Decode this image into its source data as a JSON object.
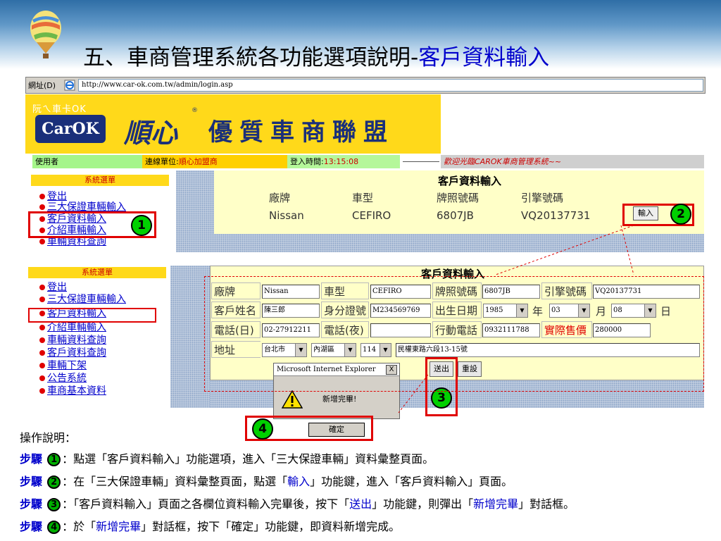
{
  "slide": {
    "title_main": "五、車商管理系統各功能選項說明-",
    "title_highlight": "客戶資料輸入"
  },
  "browser": {
    "address_label": "網址(D)",
    "url": "http://www.car-ok.com.tw/admin/login.asp"
  },
  "banner": {
    "logo_top": "阮ㄟ車卡OK",
    "logo_main": "CarOK",
    "brand_name": "順心",
    "brand_reg": "®",
    "alliance": "優質車商聯盟"
  },
  "status": {
    "user_label": "使用者",
    "unit_label": "連線單位:",
    "unit_value": "順心加盟商",
    "login_label": "登入時間:",
    "login_value": "13:15:08",
    "welcome": "歡迎光臨CAROK車商管理系統~~"
  },
  "menu_top": {
    "header": "系統選單",
    "items": [
      "登出",
      "三大保證車輛輸入",
      "客戶資料輸入",
      "介紹車輛輸入",
      "車輛資料查詢"
    ]
  },
  "panel_top": {
    "title": "客戶資料輸入",
    "headers": [
      "廠牌",
      "車型",
      "牌照號碼",
      "引擎號碼"
    ],
    "values": [
      "Nissan",
      "CEFIRO",
      "6807JB",
      "VQ20137731"
    ],
    "input_button": "輸入"
  },
  "menu_bottom": {
    "header": "系統選單",
    "items": [
      "登出",
      "三大保證車輛輸入",
      "客戶資料輸入",
      "介紹車輛輸入",
      "車輛資料查詢",
      "客戶資料查詢",
      "車輛下架",
      "公告系統",
      "車商基本資料"
    ]
  },
  "form": {
    "title": "客戶資料輸入",
    "brand_label": "廠牌",
    "brand_value": "Nissan",
    "model_label": "車型",
    "model_value": "CEFIRO",
    "plate_label": "牌照號碼",
    "plate_value": "6807JB",
    "engine_label": "引擎號碼",
    "engine_value": "VQ20137731",
    "name_label": "客戶姓名",
    "name_value": "陳三郎",
    "id_label": "身分證號",
    "id_value": "M234569769",
    "birth_label": "出生日期",
    "birth_year": "1985",
    "year_unit": "年",
    "birth_month": "03",
    "month_unit": "月",
    "birth_day": "08",
    "day_unit": "日",
    "phone_day_label": "電話(日)",
    "phone_day_value": "02-27912211",
    "phone_night_label": "電話(夜)",
    "phone_night_value": "",
    "mobile_label": "行動電話",
    "mobile_value": "0932111788",
    "price_label": "實際售價",
    "price_value": "280000",
    "address_label": "地址",
    "city": "台北市",
    "district": "內湖區",
    "zip": "114",
    "street": "民權東路六段13-15號",
    "submit_button": "送出",
    "reset_button": "重設"
  },
  "dialog": {
    "title": "Microsoft Internet Explorer",
    "close": "X",
    "message": "新增完畢!",
    "ok_button": "確定"
  },
  "badges": [
    "1",
    "2",
    "3",
    "4"
  ],
  "instructions": {
    "title": "操作說明：",
    "step_label": "步驟",
    "steps": [
      {
        "num": "1",
        "text": "：點選「客戶資料輸入」功能選項，進入「三大保證車輛」資料彙整頁面。"
      },
      {
        "num": "2",
        "pre": "：在「三大保證車輛」資料彙整頁面，點選「",
        "kw": "輸入",
        "post": "」功能鍵，進入「客戶資料輸入」頁面。"
      },
      {
        "num": "3",
        "pre": "：「客戶資料輸入」頁面之各欄位資料輸入完畢後，按下「",
        "kw": "送出",
        "mid": "」功能鍵，則彈出「",
        "kw2": "新增完畢",
        "post": "」對話框。"
      },
      {
        "num": "4",
        "pre": "：於「",
        "kw": "新增完畢",
        "post": "」對話框，按下「確定」功能鍵，即資料新增完成。"
      }
    ]
  }
}
